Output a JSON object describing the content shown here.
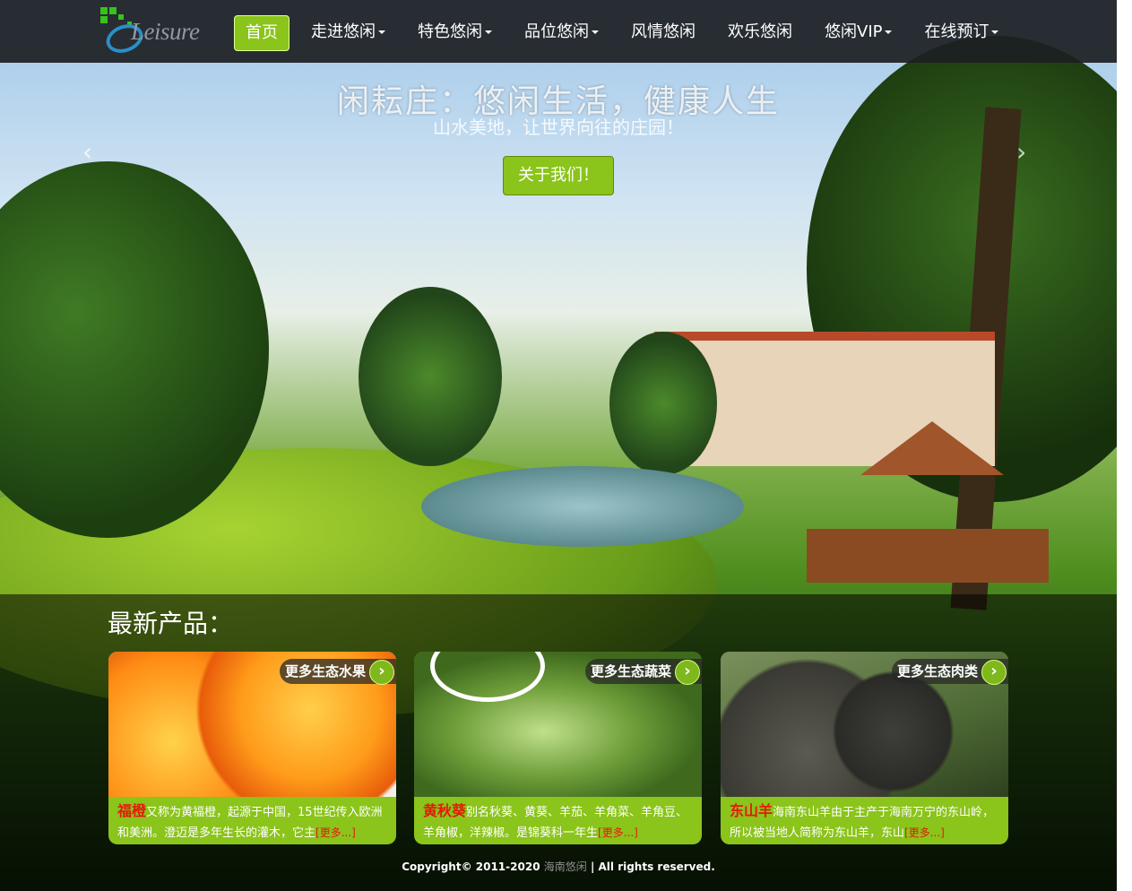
{
  "brand": {
    "logo_text": "Leisure",
    "accent": "#8bc41a"
  },
  "nav": {
    "items": [
      {
        "label": "首页",
        "active": true,
        "dropdown": false
      },
      {
        "label": "走进悠闲",
        "active": false,
        "dropdown": true
      },
      {
        "label": "特色悠闲",
        "active": false,
        "dropdown": true
      },
      {
        "label": "品位悠闲",
        "active": false,
        "dropdown": true
      },
      {
        "label": "风情悠闲",
        "active": false,
        "dropdown": false
      },
      {
        "label": "欢乐悠闲",
        "active": false,
        "dropdown": false
      },
      {
        "label": "悠闲VIP",
        "active": false,
        "dropdown": true
      },
      {
        "label": "在线预订",
        "active": false,
        "dropdown": true
      }
    ]
  },
  "hero": {
    "title": "闲耘庄：悠闲生活，健康人生",
    "subtitle": "山水美地，让世界向往的庄园！",
    "button": "关于我们！",
    "prev_icon": "chevron-left-icon",
    "next_icon": "chevron-right-icon"
  },
  "products": {
    "heading": "最新产品：",
    "cards": [
      {
        "more": "更多生态水果",
        "name": "福橙",
        "text": "又称为黄福橙，起源于中国，15世纪传入欧洲和美洲。澄迈是多年生长的灌木，它主",
        "read_more": "[更多...]"
      },
      {
        "more": "更多生态蔬菜",
        "name": "黄秋葵",
        "text": "别名秋葵、黄葵、羊茄、羊角菜、羊角豆、羊角椒，洋辣椒。是锦葵科一年生",
        "read_more": "[更多...]"
      },
      {
        "more": "更多生态肉类",
        "name": "东山羊",
        "text": "海南东山羊由于主产于海南万宁的东山岭，所以被当地人简称为东山羊，东山",
        "read_more": "[更多...]"
      }
    ]
  },
  "footer": {
    "prefix": "Copyright© 2011-2020",
    "site": "海南悠闲",
    "suffix": "| All rights reserved."
  }
}
